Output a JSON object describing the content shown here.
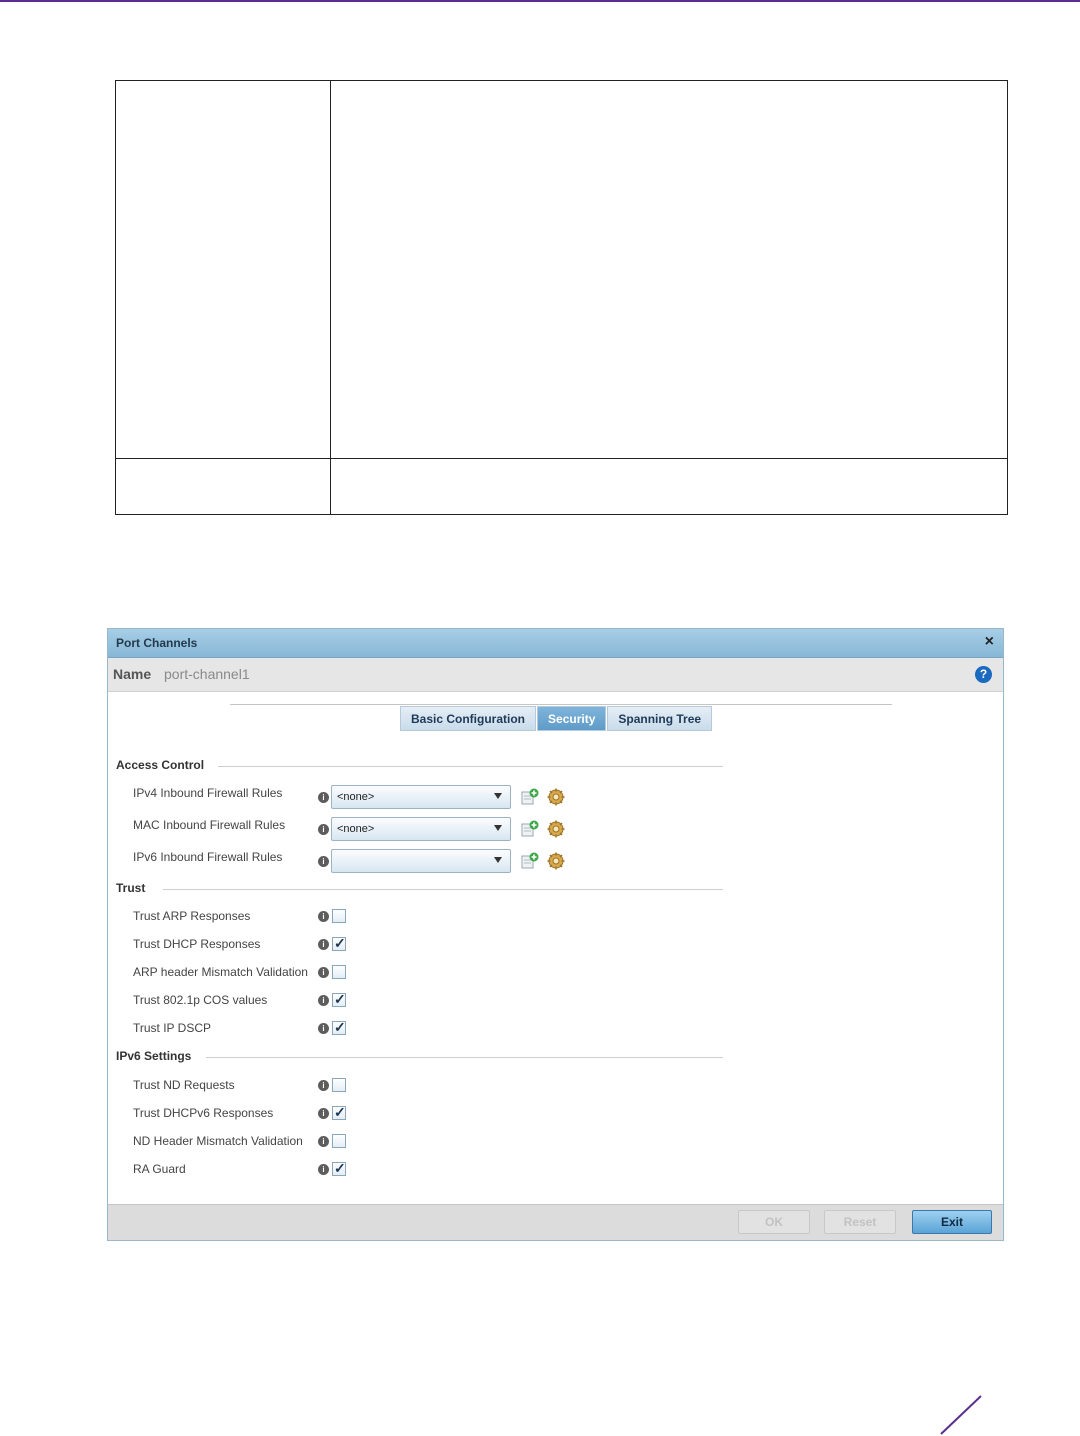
{
  "dialog": {
    "title": "Port Channels",
    "close_glyph": "×",
    "name_label": "Name",
    "name_value": "port-channel1",
    "help_glyph": "?"
  },
  "tabs": [
    {
      "label": "Basic Configuration",
      "active": false
    },
    {
      "label": "Security",
      "active": true
    },
    {
      "label": "Spanning Tree",
      "active": false
    }
  ],
  "access_control": {
    "title": "Access Control",
    "rows": [
      {
        "label": "IPv4 Inbound Firewall Rules",
        "value": "<none>"
      },
      {
        "label": "MAC Inbound Firewall Rules",
        "value": "<none>"
      },
      {
        "label": "IPv6 Inbound Firewall Rules",
        "value": ""
      }
    ]
  },
  "trust": {
    "title": "Trust",
    "rows": [
      {
        "label": "Trust ARP Responses",
        "checked": false
      },
      {
        "label": "Trust DHCP Responses",
        "checked": true
      },
      {
        "label": "ARP header Mismatch Validation",
        "checked": false
      },
      {
        "label": "Trust 802.1p COS values",
        "checked": true
      },
      {
        "label": "Trust IP DSCP",
        "checked": true
      }
    ]
  },
  "ipv6_settings": {
    "title": "IPv6 Settings",
    "rows": [
      {
        "label": "Trust ND Requests",
        "checked": false
      },
      {
        "label": "Trust DHCPv6 Responses",
        "checked": true
      },
      {
        "label": "ND Header Mismatch Validation",
        "checked": false
      },
      {
        "label": "RA Guard",
        "checked": true
      }
    ]
  },
  "footer": {
    "ok_label": "OK",
    "reset_label": "Reset",
    "exit_label": "Exit"
  },
  "icons": {
    "info": "info-icon",
    "create": "create-rule-icon",
    "edit": "edit-rule-gear-icon",
    "help": "help-icon",
    "close": "close-icon"
  },
  "colors": {
    "brand_rule": "#5b2d8e",
    "active_tab": "#5f9cc9",
    "help": "#1a6ac0"
  }
}
